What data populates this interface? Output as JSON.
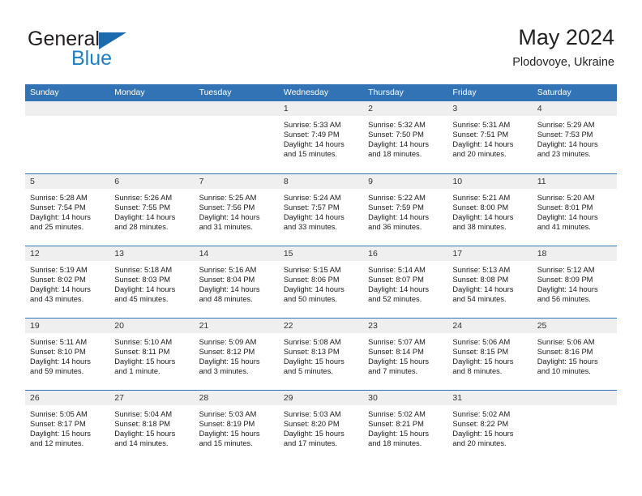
{
  "brand": {
    "name_part1": "General",
    "name_part2": "Blue"
  },
  "header": {
    "title": "May 2024",
    "subtitle": "Plodovoye, Ukraine"
  },
  "colors": {
    "header_blue": "#3173b4",
    "brand_blue": "#1f7fc4",
    "day_band_gray": "#efefef"
  },
  "weekdays": [
    "Sunday",
    "Monday",
    "Tuesday",
    "Wednesday",
    "Thursday",
    "Friday",
    "Saturday"
  ],
  "weeks": [
    [
      {
        "day": "",
        "lines": []
      },
      {
        "day": "",
        "lines": []
      },
      {
        "day": "",
        "lines": []
      },
      {
        "day": "1",
        "lines": [
          "Sunrise: 5:33 AM",
          "Sunset: 7:49 PM",
          "Daylight: 14 hours",
          "and 15 minutes."
        ]
      },
      {
        "day": "2",
        "lines": [
          "Sunrise: 5:32 AM",
          "Sunset: 7:50 PM",
          "Daylight: 14 hours",
          "and 18 minutes."
        ]
      },
      {
        "day": "3",
        "lines": [
          "Sunrise: 5:31 AM",
          "Sunset: 7:51 PM",
          "Daylight: 14 hours",
          "and 20 minutes."
        ]
      },
      {
        "day": "4",
        "lines": [
          "Sunrise: 5:29 AM",
          "Sunset: 7:53 PM",
          "Daylight: 14 hours",
          "and 23 minutes."
        ]
      }
    ],
    [
      {
        "day": "5",
        "lines": [
          "Sunrise: 5:28 AM",
          "Sunset: 7:54 PM",
          "Daylight: 14 hours",
          "and 25 minutes."
        ]
      },
      {
        "day": "6",
        "lines": [
          "Sunrise: 5:26 AM",
          "Sunset: 7:55 PM",
          "Daylight: 14 hours",
          "and 28 minutes."
        ]
      },
      {
        "day": "7",
        "lines": [
          "Sunrise: 5:25 AM",
          "Sunset: 7:56 PM",
          "Daylight: 14 hours",
          "and 31 minutes."
        ]
      },
      {
        "day": "8",
        "lines": [
          "Sunrise: 5:24 AM",
          "Sunset: 7:57 PM",
          "Daylight: 14 hours",
          "and 33 minutes."
        ]
      },
      {
        "day": "9",
        "lines": [
          "Sunrise: 5:22 AM",
          "Sunset: 7:59 PM",
          "Daylight: 14 hours",
          "and 36 minutes."
        ]
      },
      {
        "day": "10",
        "lines": [
          "Sunrise: 5:21 AM",
          "Sunset: 8:00 PM",
          "Daylight: 14 hours",
          "and 38 minutes."
        ]
      },
      {
        "day": "11",
        "lines": [
          "Sunrise: 5:20 AM",
          "Sunset: 8:01 PM",
          "Daylight: 14 hours",
          "and 41 minutes."
        ]
      }
    ],
    [
      {
        "day": "12",
        "lines": [
          "Sunrise: 5:19 AM",
          "Sunset: 8:02 PM",
          "Daylight: 14 hours",
          "and 43 minutes."
        ]
      },
      {
        "day": "13",
        "lines": [
          "Sunrise: 5:18 AM",
          "Sunset: 8:03 PM",
          "Daylight: 14 hours",
          "and 45 minutes."
        ]
      },
      {
        "day": "14",
        "lines": [
          "Sunrise: 5:16 AM",
          "Sunset: 8:04 PM",
          "Daylight: 14 hours",
          "and 48 minutes."
        ]
      },
      {
        "day": "15",
        "lines": [
          "Sunrise: 5:15 AM",
          "Sunset: 8:06 PM",
          "Daylight: 14 hours",
          "and 50 minutes."
        ]
      },
      {
        "day": "16",
        "lines": [
          "Sunrise: 5:14 AM",
          "Sunset: 8:07 PM",
          "Daylight: 14 hours",
          "and 52 minutes."
        ]
      },
      {
        "day": "17",
        "lines": [
          "Sunrise: 5:13 AM",
          "Sunset: 8:08 PM",
          "Daylight: 14 hours",
          "and 54 minutes."
        ]
      },
      {
        "day": "18",
        "lines": [
          "Sunrise: 5:12 AM",
          "Sunset: 8:09 PM",
          "Daylight: 14 hours",
          "and 56 minutes."
        ]
      }
    ],
    [
      {
        "day": "19",
        "lines": [
          "Sunrise: 5:11 AM",
          "Sunset: 8:10 PM",
          "Daylight: 14 hours",
          "and 59 minutes."
        ]
      },
      {
        "day": "20",
        "lines": [
          "Sunrise: 5:10 AM",
          "Sunset: 8:11 PM",
          "Daylight: 15 hours",
          "and 1 minute."
        ]
      },
      {
        "day": "21",
        "lines": [
          "Sunrise: 5:09 AM",
          "Sunset: 8:12 PM",
          "Daylight: 15 hours",
          "and 3 minutes."
        ]
      },
      {
        "day": "22",
        "lines": [
          "Sunrise: 5:08 AM",
          "Sunset: 8:13 PM",
          "Daylight: 15 hours",
          "and 5 minutes."
        ]
      },
      {
        "day": "23",
        "lines": [
          "Sunrise: 5:07 AM",
          "Sunset: 8:14 PM",
          "Daylight: 15 hours",
          "and 7 minutes."
        ]
      },
      {
        "day": "24",
        "lines": [
          "Sunrise: 5:06 AM",
          "Sunset: 8:15 PM",
          "Daylight: 15 hours",
          "and 8 minutes."
        ]
      },
      {
        "day": "25",
        "lines": [
          "Sunrise: 5:06 AM",
          "Sunset: 8:16 PM",
          "Daylight: 15 hours",
          "and 10 minutes."
        ]
      }
    ],
    [
      {
        "day": "26",
        "lines": [
          "Sunrise: 5:05 AM",
          "Sunset: 8:17 PM",
          "Daylight: 15 hours",
          "and 12 minutes."
        ]
      },
      {
        "day": "27",
        "lines": [
          "Sunrise: 5:04 AM",
          "Sunset: 8:18 PM",
          "Daylight: 15 hours",
          "and 14 minutes."
        ]
      },
      {
        "day": "28",
        "lines": [
          "Sunrise: 5:03 AM",
          "Sunset: 8:19 PM",
          "Daylight: 15 hours",
          "and 15 minutes."
        ]
      },
      {
        "day": "29",
        "lines": [
          "Sunrise: 5:03 AM",
          "Sunset: 8:20 PM",
          "Daylight: 15 hours",
          "and 17 minutes."
        ]
      },
      {
        "day": "30",
        "lines": [
          "Sunrise: 5:02 AM",
          "Sunset: 8:21 PM",
          "Daylight: 15 hours",
          "and 18 minutes."
        ]
      },
      {
        "day": "31",
        "lines": [
          "Sunrise: 5:02 AM",
          "Sunset: 8:22 PM",
          "Daylight: 15 hours",
          "and 20 minutes."
        ]
      },
      {
        "day": "",
        "lines": []
      }
    ]
  ]
}
